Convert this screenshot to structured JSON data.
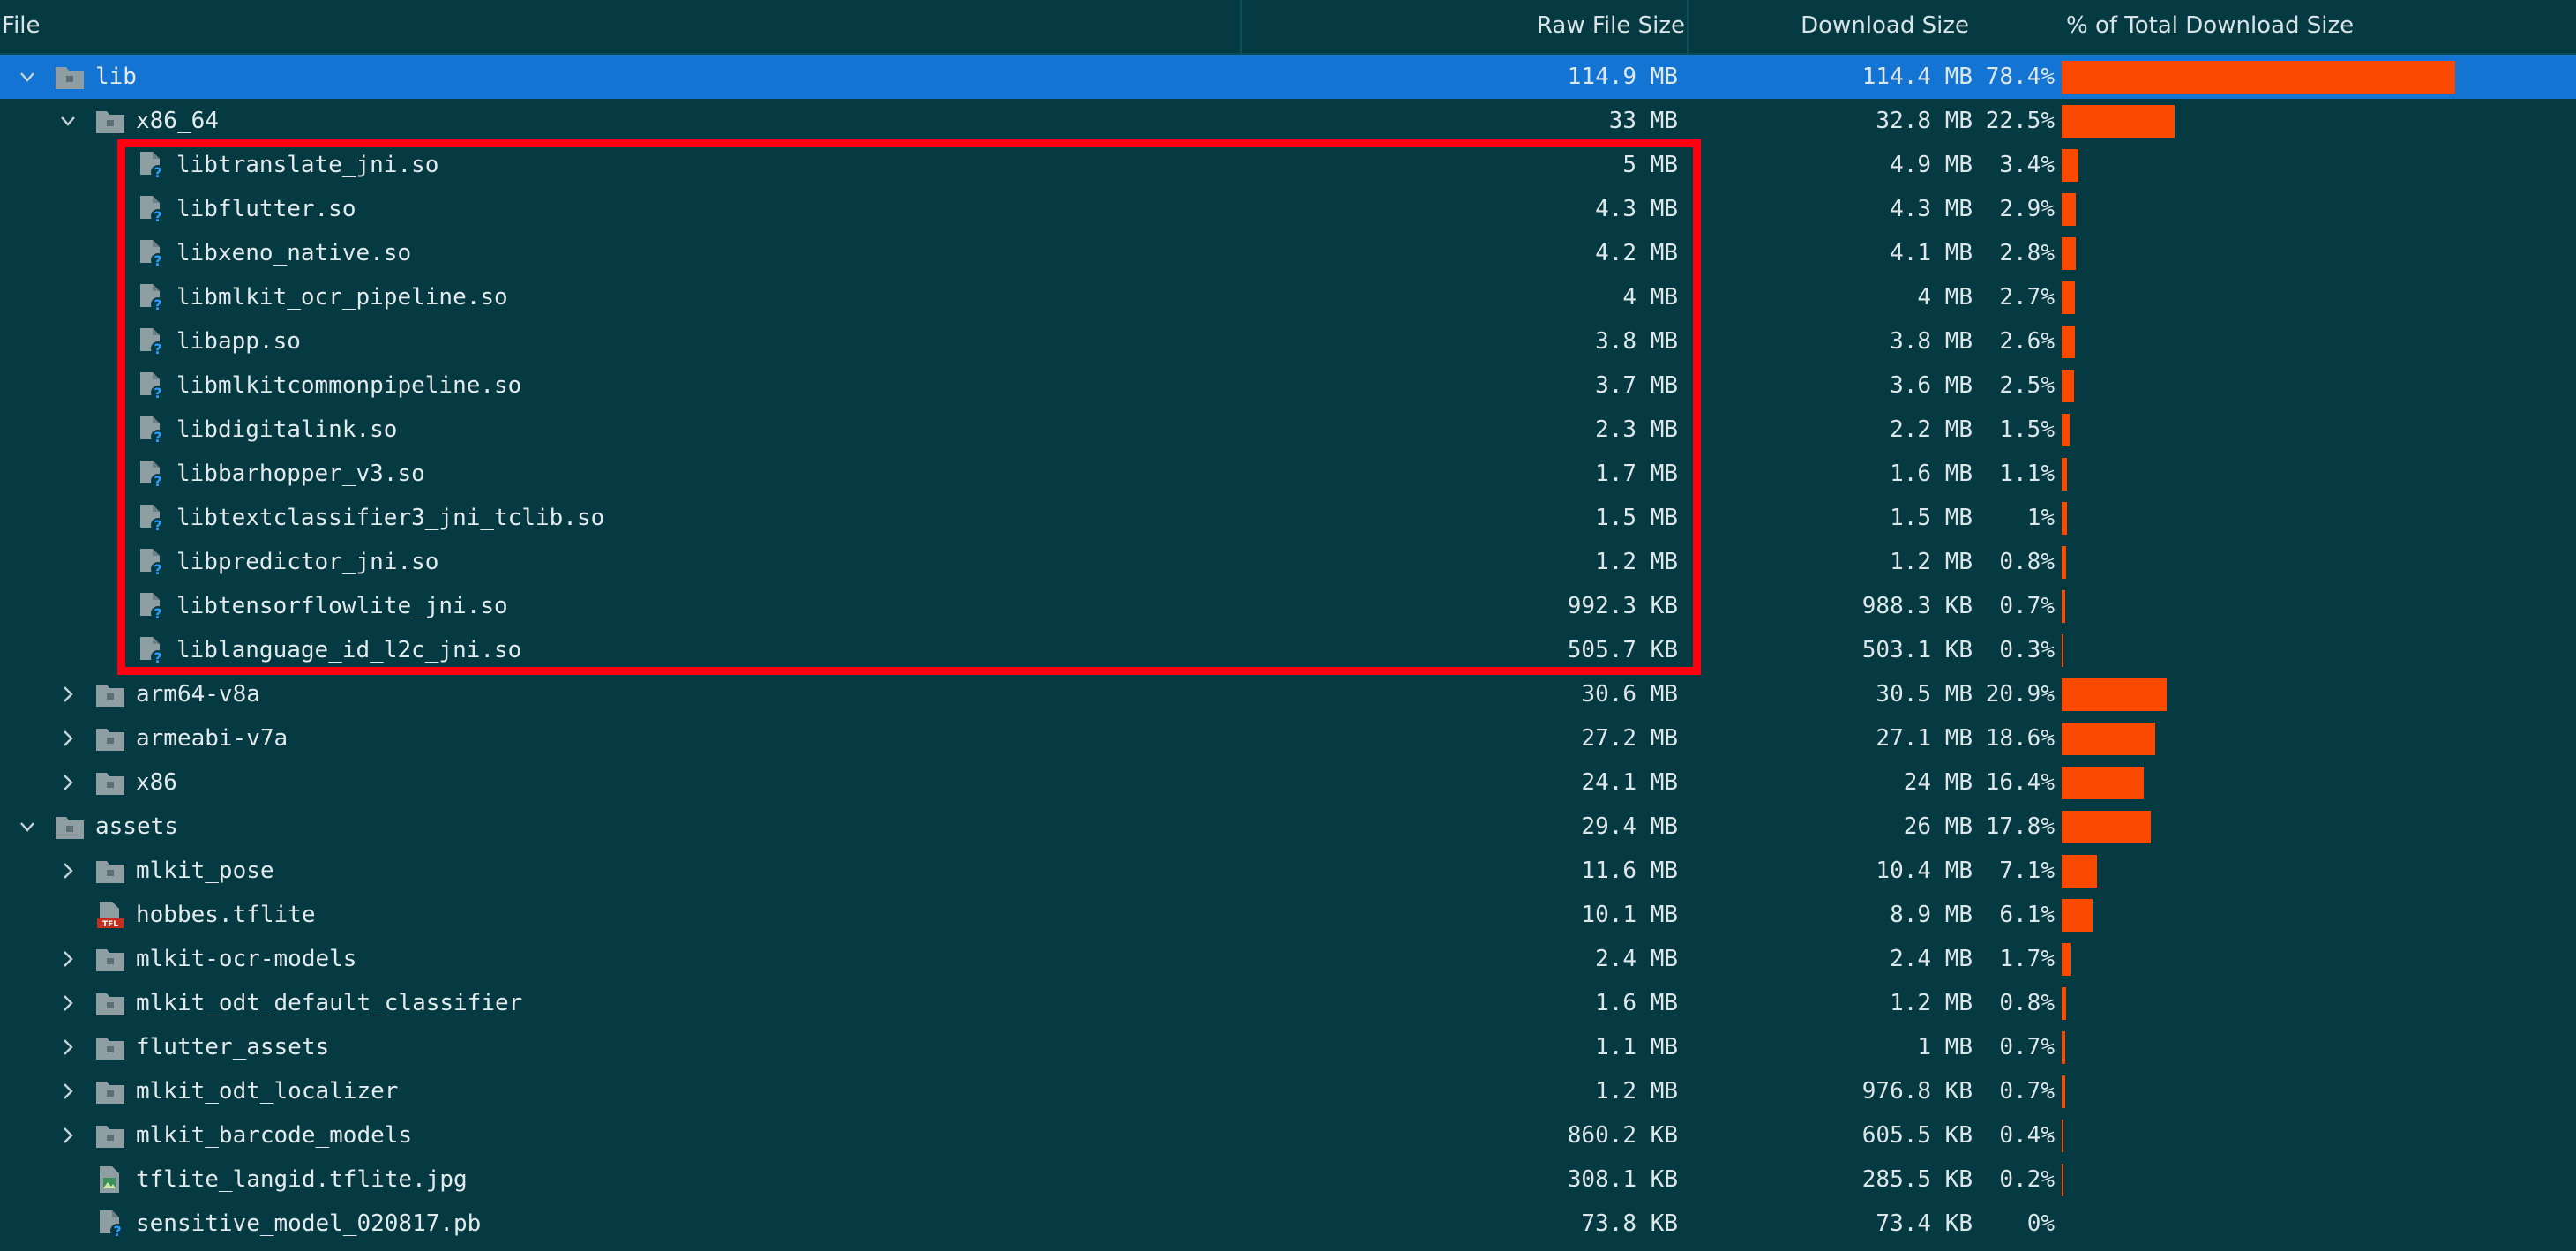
{
  "columns": {
    "file": "File",
    "raw": "Raw File Size",
    "download": "Download Size",
    "percent": "% of Total Download Size"
  },
  "colors": {
    "background": "#063a43",
    "selected_row": "#1474d4",
    "bar": "#fb4a00",
    "highlight_box": "#ff0010"
  },
  "rows": [
    {
      "name": "lib",
      "type": "folder",
      "indent": 0,
      "expanded": true,
      "selected": true,
      "raw": "114.9 MB",
      "download": "114.4 MB",
      "percent": "78.4%",
      "share": 0.784
    },
    {
      "name": "x86_64",
      "type": "folder",
      "indent": 1,
      "expanded": true,
      "raw": "33 MB",
      "download": "32.8 MB",
      "percent": "22.5%",
      "share": 0.225
    },
    {
      "name": "libtranslate_jni.so",
      "type": "unknown-file",
      "indent": 2,
      "raw": "5 MB",
      "download": "4.9 MB",
      "percent": "3.4%",
      "share": 0.034
    },
    {
      "name": "libflutter.so",
      "type": "unknown-file",
      "indent": 2,
      "raw": "4.3 MB",
      "download": "4.3 MB",
      "percent": "2.9%",
      "share": 0.029
    },
    {
      "name": "libxeno_native.so",
      "type": "unknown-file",
      "indent": 2,
      "raw": "4.2 MB",
      "download": "4.1 MB",
      "percent": "2.8%",
      "share": 0.028
    },
    {
      "name": "libmlkit_ocr_pipeline.so",
      "type": "unknown-file",
      "indent": 2,
      "raw": "4 MB",
      "download": "4 MB",
      "percent": "2.7%",
      "share": 0.027
    },
    {
      "name": "libapp.so",
      "type": "unknown-file",
      "indent": 2,
      "raw": "3.8 MB",
      "download": "3.8 MB",
      "percent": "2.6%",
      "share": 0.026
    },
    {
      "name": "libmlkitcommonpipeline.so",
      "type": "unknown-file",
      "indent": 2,
      "raw": "3.7 MB",
      "download": "3.6 MB",
      "percent": "2.5%",
      "share": 0.025
    },
    {
      "name": "libdigitalink.so",
      "type": "unknown-file",
      "indent": 2,
      "raw": "2.3 MB",
      "download": "2.2 MB",
      "percent": "1.5%",
      "share": 0.015
    },
    {
      "name": "libbarhopper_v3.so",
      "type": "unknown-file",
      "indent": 2,
      "raw": "1.7 MB",
      "download": "1.6 MB",
      "percent": "1.1%",
      "share": 0.011
    },
    {
      "name": "libtextclassifier3_jni_tclib.so",
      "type": "unknown-file",
      "indent": 2,
      "raw": "1.5 MB",
      "download": "1.5 MB",
      "percent": "1%",
      "share": 0.01
    },
    {
      "name": "libpredictor_jni.so",
      "type": "unknown-file",
      "indent": 2,
      "raw": "1.2 MB",
      "download": "1.2 MB",
      "percent": "0.8%",
      "share": 0.008
    },
    {
      "name": "libtensorflowlite_jni.so",
      "type": "unknown-file",
      "indent": 2,
      "raw": "992.3 KB",
      "download": "988.3 KB",
      "percent": "0.7%",
      "share": 0.007
    },
    {
      "name": "liblanguage_id_l2c_jni.so",
      "type": "unknown-file",
      "indent": 2,
      "raw": "505.7 KB",
      "download": "503.1 KB",
      "percent": "0.3%",
      "share": 0.003
    },
    {
      "name": "arm64-v8a",
      "type": "folder",
      "indent": 1,
      "expanded": false,
      "raw": "30.6 MB",
      "download": "30.5 MB",
      "percent": "20.9%",
      "share": 0.209
    },
    {
      "name": "armeabi-v7a",
      "type": "folder",
      "indent": 1,
      "expanded": false,
      "raw": "27.2 MB",
      "download": "27.1 MB",
      "percent": "18.6%",
      "share": 0.186
    },
    {
      "name": "x86",
      "type": "folder",
      "indent": 1,
      "expanded": false,
      "raw": "24.1 MB",
      "download": "24 MB",
      "percent": "16.4%",
      "share": 0.164
    },
    {
      "name": "assets",
      "type": "folder",
      "indent": 0,
      "expanded": true,
      "raw": "29.4 MB",
      "download": "26 MB",
      "percent": "17.8%",
      "share": 0.178
    },
    {
      "name": "mlkit_pose",
      "type": "folder",
      "indent": 1,
      "expanded": false,
      "raw": "11.6 MB",
      "download": "10.4 MB",
      "percent": "7.1%",
      "share": 0.071
    },
    {
      "name": "hobbes.tflite",
      "type": "tflite-file",
      "indent": 1,
      "raw": "10.1 MB",
      "download": "8.9 MB",
      "percent": "6.1%",
      "share": 0.061
    },
    {
      "name": "mlkit-ocr-models",
      "type": "folder",
      "indent": 1,
      "expanded": false,
      "raw": "2.4 MB",
      "download": "2.4 MB",
      "percent": "1.7%",
      "share": 0.017
    },
    {
      "name": "mlkit_odt_default_classifier",
      "type": "folder",
      "indent": 1,
      "expanded": false,
      "raw": "1.6 MB",
      "download": "1.2 MB",
      "percent": "0.8%",
      "share": 0.008
    },
    {
      "name": "flutter_assets",
      "type": "folder",
      "indent": 1,
      "expanded": false,
      "raw": "1.1 MB",
      "download": "1 MB",
      "percent": "0.7%",
      "share": 0.007
    },
    {
      "name": "mlkit_odt_localizer",
      "type": "folder",
      "indent": 1,
      "expanded": false,
      "raw": "1.2 MB",
      "download": "976.8 KB",
      "percent": "0.7%",
      "share": 0.007
    },
    {
      "name": "mlkit_barcode_models",
      "type": "folder",
      "indent": 1,
      "expanded": false,
      "raw": "860.2 KB",
      "download": "605.5 KB",
      "percent": "0.4%",
      "share": 0.004
    },
    {
      "name": "tflite_langid.tflite.jpg",
      "type": "image-file",
      "indent": 1,
      "raw": "308.1 KB",
      "download": "285.5 KB",
      "percent": "0.2%",
      "share": 0.002
    },
    {
      "name": "sensitive_model_020817.pb",
      "type": "unknown-file",
      "indent": 1,
      "raw": "73.8 KB",
      "download": "73.4 KB",
      "percent": "0%",
      "share": 0.0
    }
  ]
}
